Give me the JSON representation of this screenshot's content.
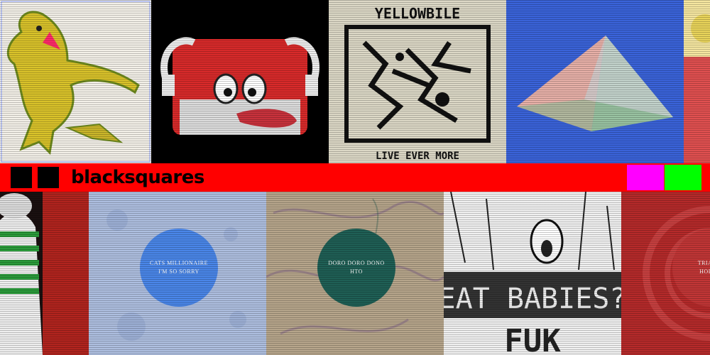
{
  "banner": {
    "brand": "blacksquares",
    "colors": {
      "bar": "#ff0000",
      "squares": "#000000",
      "swatch_magenta": "#ff00ff",
      "swatch_green": "#00ff00"
    }
  },
  "top_row": [
    {
      "kind": "cover-art",
      "subject": "yellow-bird-figure"
    },
    {
      "kind": "cover-art",
      "subject": "red-cartoon-face"
    },
    {
      "kind": "cover-art",
      "title": "YELLOWBILE",
      "subtitle": "LIVE EVER MORE"
    },
    {
      "kind": "cover-art",
      "subject": "pyramid"
    },
    {
      "kind": "cover-art",
      "subject": "partial-cover"
    }
  ],
  "bottom_row": [
    {
      "kind": "cover-art",
      "subject": "striped-figure"
    },
    {
      "kind": "cover-art",
      "artist": "CATS MILLIONAIRE",
      "title": "I'M SO SORRY"
    },
    {
      "kind": "cover-art",
      "artist": "DORO DORO DONO",
      "title": "HTO"
    },
    {
      "kind": "cover-art",
      "title": "EAT BABIES?",
      "subtitle": "FUK"
    },
    {
      "kind": "cover-art",
      "artist": "TRIANGL",
      "title": "HOLIDA"
    }
  ]
}
